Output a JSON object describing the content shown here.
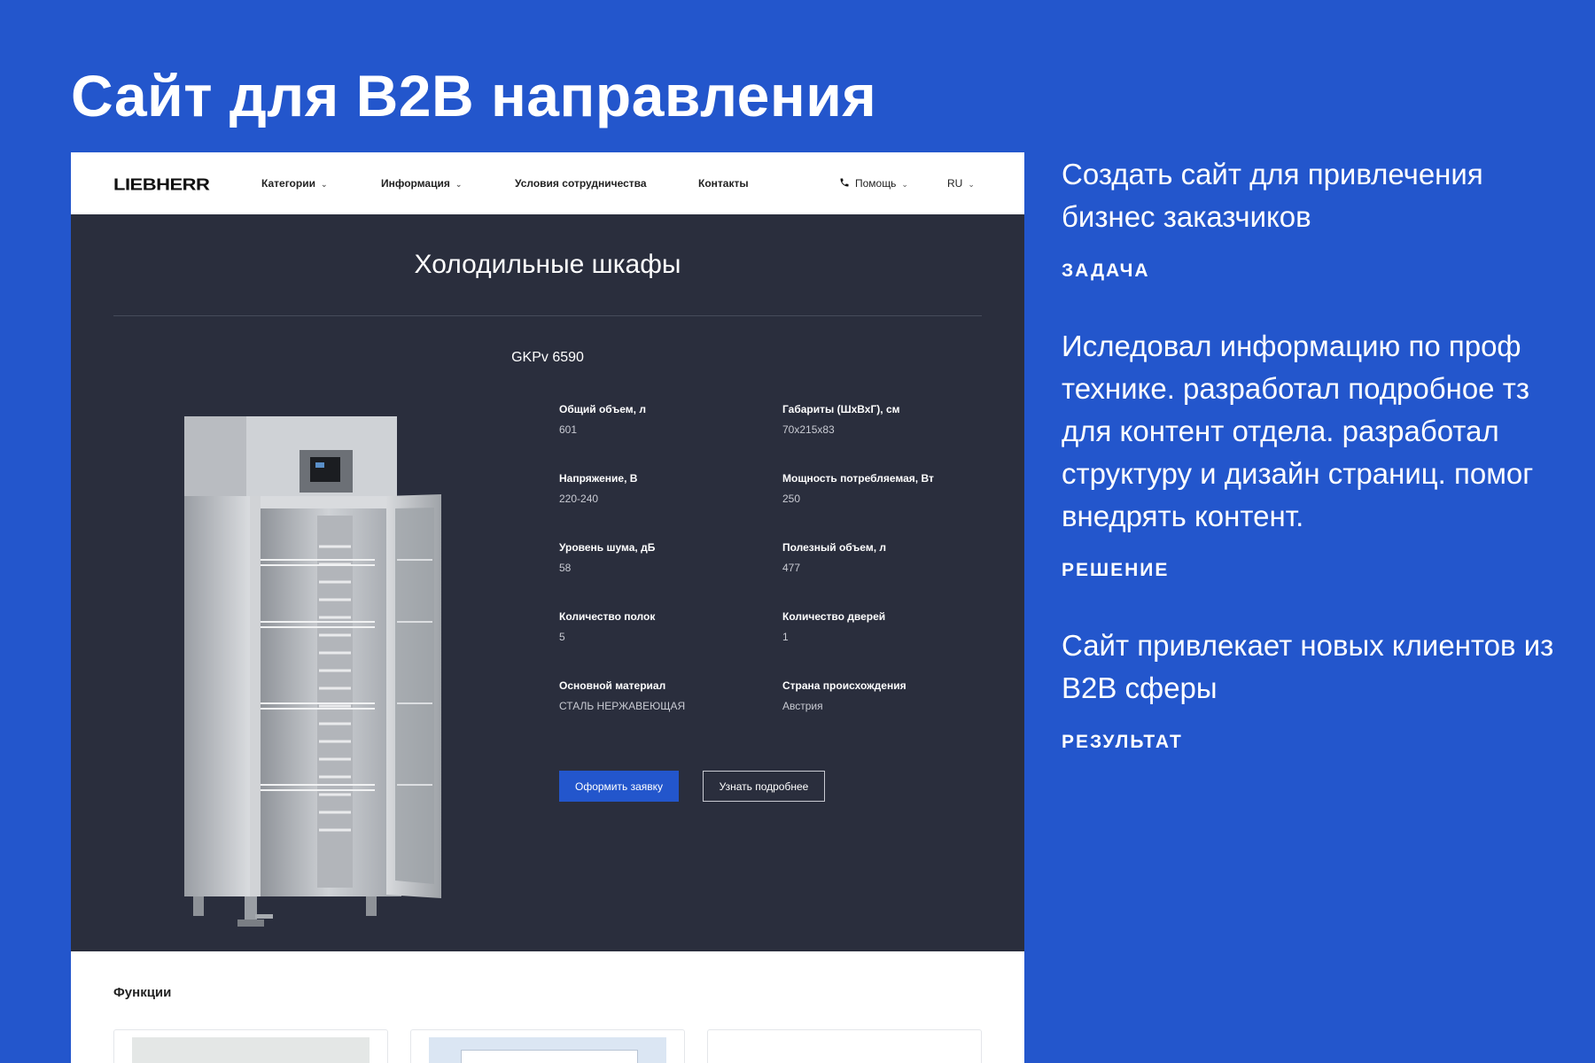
{
  "page": {
    "title": "Сайт для B2B направления"
  },
  "site": {
    "logo": "LIEBHERR",
    "nav": {
      "categories": "Категории",
      "info": "Информация",
      "terms": "Условия сотрудничества",
      "contacts": "Контакты",
      "help": "Помощь",
      "lang": "RU"
    },
    "hero": {
      "title": "Холодильные шкафы",
      "model": "GKPv 6590"
    },
    "specs": [
      {
        "label": "Общий объем, л",
        "value": "601"
      },
      {
        "label": "Габариты (ШхВхГ), см",
        "value": "70x215x83"
      },
      {
        "label": "Напряжение, В",
        "value": "220-240"
      },
      {
        "label": "Мощность потребляемая, Вт",
        "value": "250"
      },
      {
        "label": "Уровень шума, дБ",
        "value": "58"
      },
      {
        "label": "Полезный объем, л",
        "value": "477"
      },
      {
        "label": "Количество полок",
        "value": "5"
      },
      {
        "label": "Количество дверей",
        "value": "1"
      },
      {
        "label": "Основной материал",
        "value": "СТАЛЬ НЕРЖАВЕЮЩАЯ"
      },
      {
        "label": "Страна происхождения",
        "value": "Австрия"
      }
    ],
    "buttons": {
      "order": "Оформить заявку",
      "more": "Узнать подробнее"
    },
    "functions_title": "Функции"
  },
  "description": {
    "task_text": "Создать сайт для привлечения бизнес заказчиков",
    "task_label": "ЗАДАЧА",
    "solution_text": "Иследовал информацию по проф технике. разработал подробное тз для контент отдела. разработал структуру и дизайн страниц. помог внедрять контент.",
    "solution_label": "РЕШЕНИЕ",
    "result_text": "Сайт привлекает новых клиентов из B2B сферы",
    "result_label": "РЕЗУЛЬТАТ"
  },
  "colors": {
    "background": "#2356cc",
    "hero": "#2a2e3d",
    "accent_button": "#2356cc"
  },
  "icons": [
    "phone-icon",
    "chevron-down-icon",
    "fridge-image"
  ]
}
